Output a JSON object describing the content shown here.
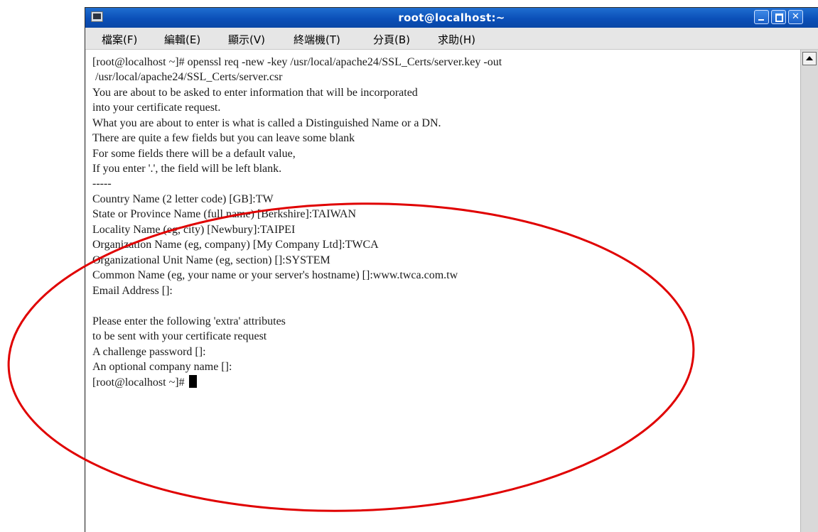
{
  "window": {
    "title": "root@localhost:~"
  },
  "menu": {
    "items": [
      "檔案(F)",
      "編輯(E)",
      "顯示(V)",
      "終端機(T)",
      "分頁(B)",
      "求助(H)"
    ]
  },
  "terminal": {
    "lines": [
      "[root@localhost ~]# openssl req -new -key /usr/local/apache24/SSL_Certs/server.key -out",
      " /usr/local/apache24/SSL_Certs/server.csr",
      "You are about to be asked to enter information that will be incorporated",
      "into your certificate request.",
      "What you are about to enter is what is called a Distinguished Name or a DN.",
      "There are quite a few fields but you can leave some blank",
      "For some fields there will be a default value,",
      "If you enter '.', the field will be left blank.",
      "-----",
      "Country Name (2 letter code) [GB]:TW",
      "State or Province Name (full name) [Berkshire]:TAIWAN",
      "Locality Name (eg, city) [Newbury]:TAIPEI",
      "Organization Name (eg, company) [My Company Ltd]:TWCA",
      "Organizational Unit Name (eg, section) []:SYSTEM",
      "Common Name (eg, your name or your server's hostname) []:www.twca.com.tw",
      "Email Address []:",
      "",
      "Please enter the following 'extra' attributes",
      "to be sent with your certificate request",
      "A challenge password []:",
      "An optional company name []:",
      "[root@localhost ~]# "
    ]
  },
  "annotation": {
    "color": "#e00000"
  }
}
